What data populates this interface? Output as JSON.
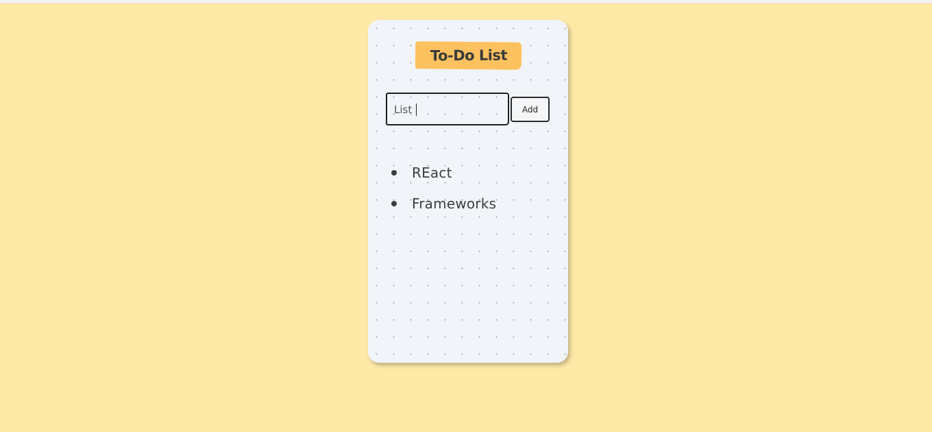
{
  "app": {
    "title": "To-Do List"
  },
  "input": {
    "value": "List",
    "placeholder": ""
  },
  "add_button": {
    "label": "Add"
  },
  "todos": [
    {
      "text": "REact"
    },
    {
      "text": "Frameworks"
    }
  ],
  "colors": {
    "page_background": "#ffe9a6",
    "card_background": "#f1f4f9",
    "title_highlight": "#fdc25f",
    "text": "#3d3d3d"
  }
}
